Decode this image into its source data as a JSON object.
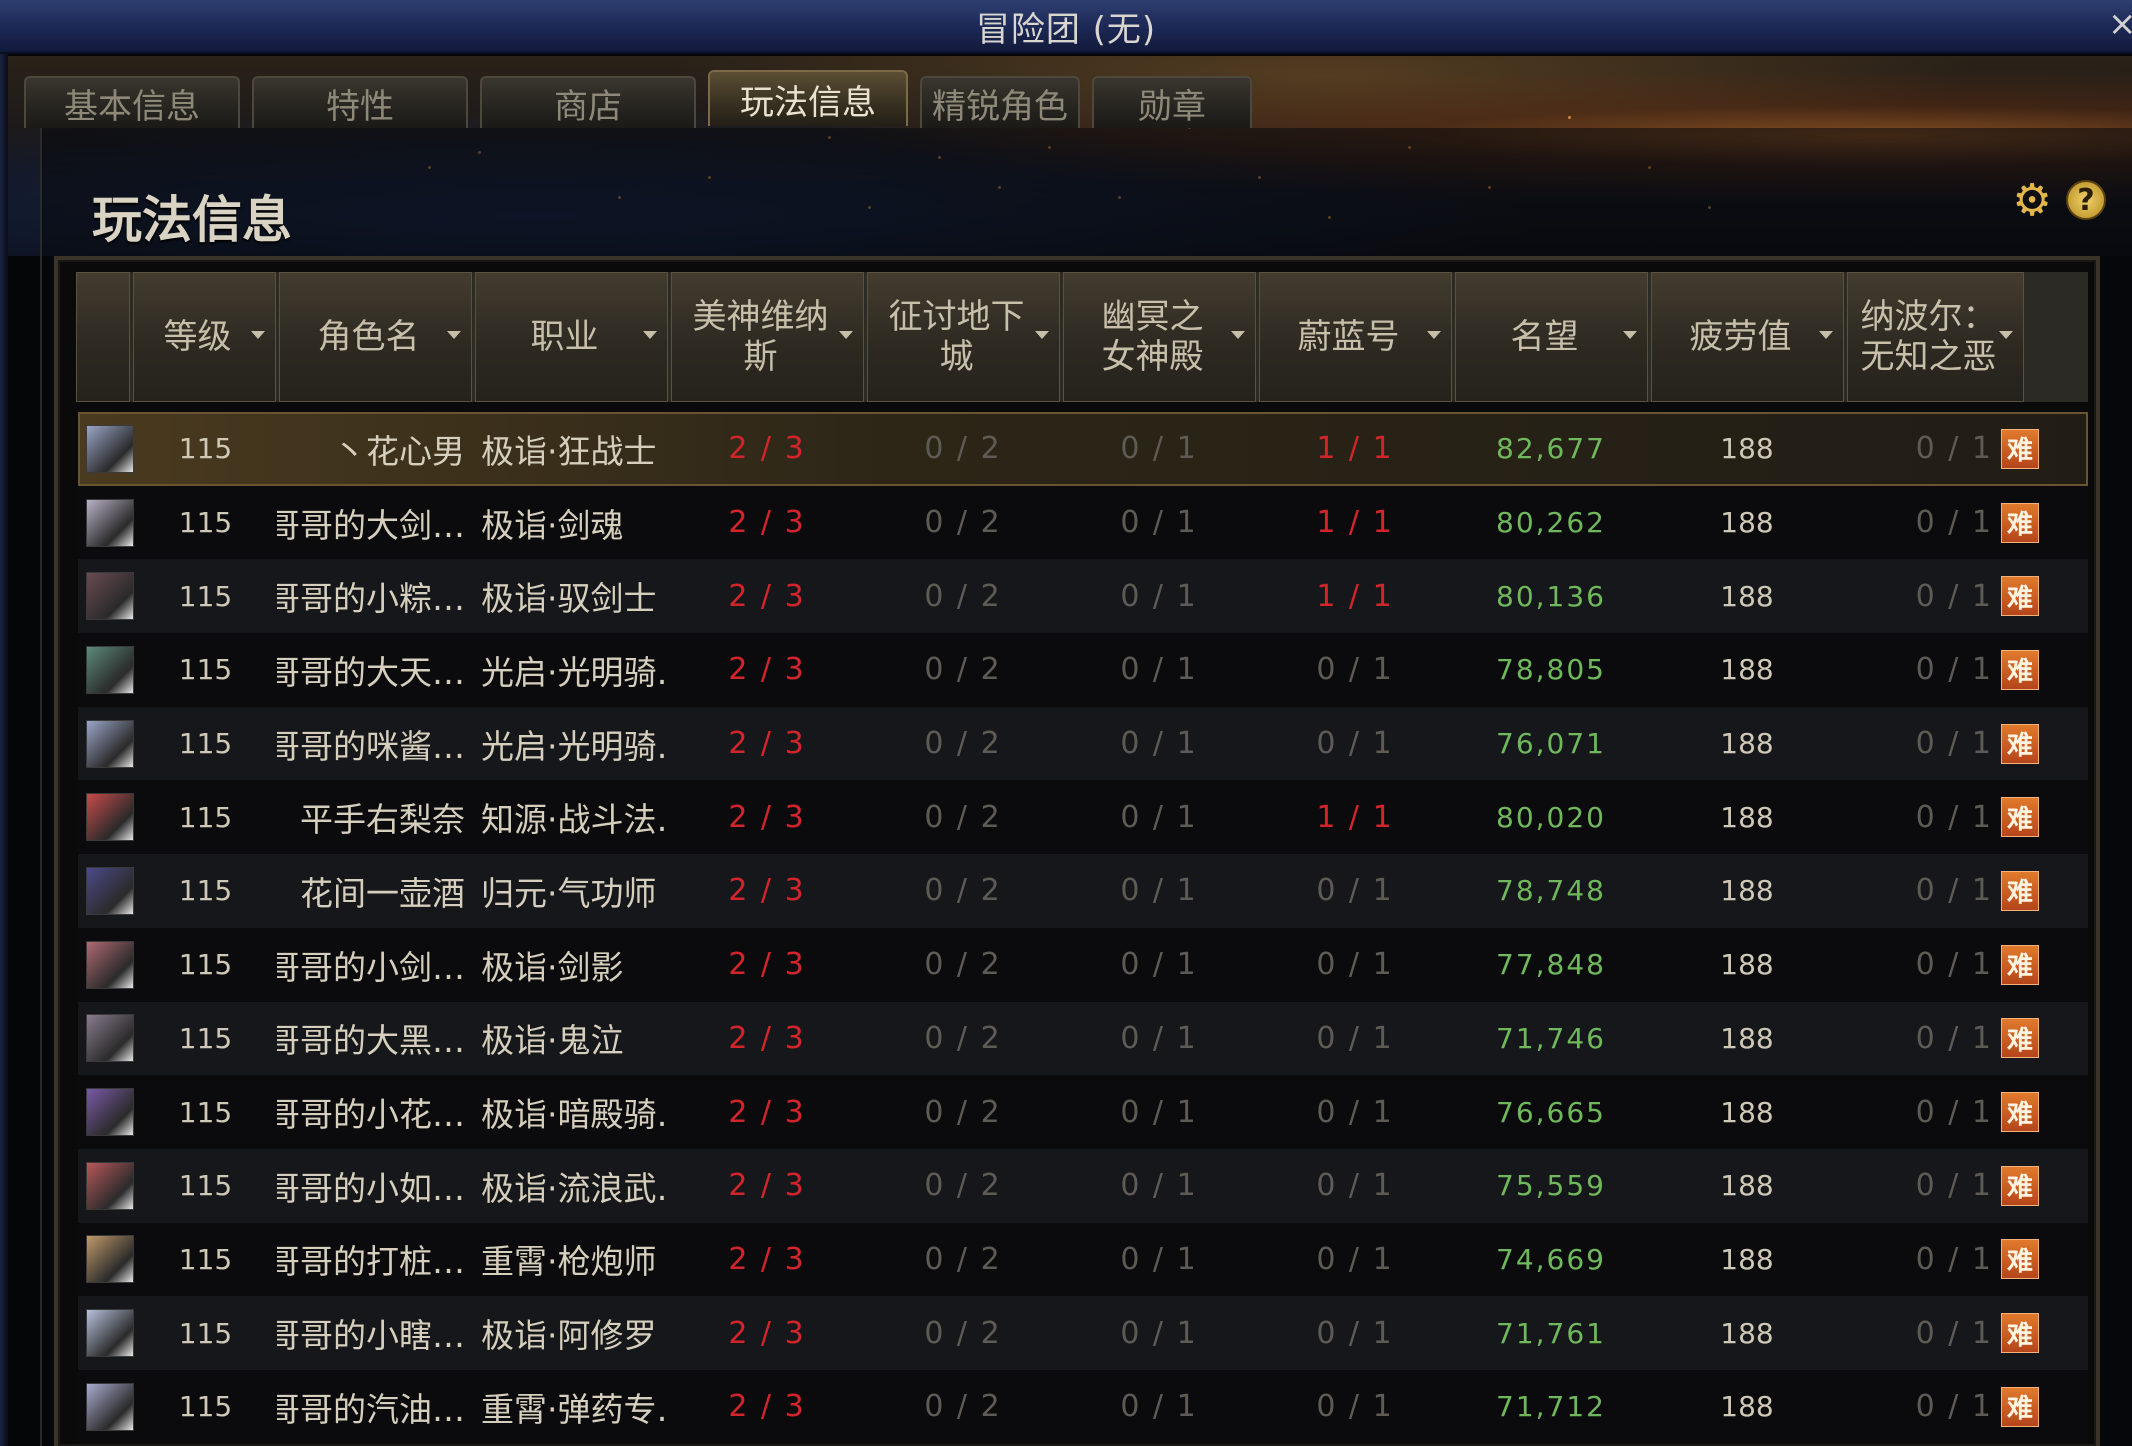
{
  "window": {
    "title": "冒险团 (无)",
    "close_glyph": "×"
  },
  "tabs": [
    {
      "label": "基本信息",
      "active": false
    },
    {
      "label": "特性",
      "active": false
    },
    {
      "label": "商店",
      "active": false
    },
    {
      "label": "玩法信息",
      "active": true
    },
    {
      "label": "精锐角色",
      "active": false
    },
    {
      "label": "勋章",
      "active": false
    }
  ],
  "panel": {
    "title": "玩法信息",
    "settings_icon": "gear-icon",
    "help_icon": "help-icon",
    "help_glyph": "?"
  },
  "columns": [
    {
      "key": "avatar",
      "label": ""
    },
    {
      "key": "level",
      "label": "等级"
    },
    {
      "key": "name",
      "label": "角色名"
    },
    {
      "key": "job",
      "label": "职业"
    },
    {
      "key": "venus",
      "label": "美神维纳\n斯"
    },
    {
      "key": "expedition",
      "label": "征讨地下\n城"
    },
    {
      "key": "goddess",
      "label": "幽冥之\n女神殿"
    },
    {
      "key": "azure",
      "label": "蔚蓝号"
    },
    {
      "key": "fame",
      "label": "名望"
    },
    {
      "key": "fatigue",
      "label": "疲劳值"
    },
    {
      "key": "nabor",
      "label": "纳波尔：\n无知之恶"
    }
  ],
  "rows": [
    {
      "level": "115",
      "name": "丶花心男",
      "job": "极诣·狂战士",
      "venus": "2 / 3",
      "expedition": "0 / 2",
      "goddess": "0 / 1",
      "azure": "1 / 1",
      "azure_done": true,
      "fame": "82,677",
      "fatigue": "188",
      "nabor": "0 / 1",
      "badge": "难",
      "avatar_color": "#9aa6c8",
      "selected": true
    },
    {
      "level": "115",
      "name": "哥哥的大剑…",
      "job": "极诣·剑魂",
      "venus": "2 / 3",
      "expedition": "0 / 2",
      "goddess": "0 / 1",
      "azure": "1 / 1",
      "azure_done": true,
      "fame": "80,262",
      "fatigue": "188",
      "nabor": "0 / 1",
      "badge": "难",
      "avatar_color": "#b9b2c7",
      "selected": false
    },
    {
      "level": "115",
      "name": "哥哥的小粽…",
      "job": "极诣·驭剑士",
      "venus": "2 / 3",
      "expedition": "0 / 2",
      "goddess": "0 / 1",
      "azure": "1 / 1",
      "azure_done": true,
      "fame": "80,136",
      "fatigue": "188",
      "nabor": "0 / 1",
      "badge": "难",
      "avatar_color": "#6a4b52",
      "selected": false
    },
    {
      "level": "115",
      "name": "哥哥的大天…",
      "job": "光启·光明骑…",
      "venus": "2 / 3",
      "expedition": "0 / 2",
      "goddess": "0 / 1",
      "azure": "0 / 1",
      "azure_done": false,
      "fame": "78,805",
      "fatigue": "188",
      "nabor": "0 / 1",
      "badge": "难",
      "avatar_color": "#5c8a7a",
      "selected": false
    },
    {
      "level": "115",
      "name": "哥哥的咪酱…",
      "job": "光启·光明骑…",
      "venus": "2 / 3",
      "expedition": "0 / 2",
      "goddess": "0 / 1",
      "azure": "0 / 1",
      "azure_done": false,
      "fame": "76,071",
      "fatigue": "188",
      "nabor": "0 / 1",
      "badge": "难",
      "avatar_color": "#9ba7c9",
      "selected": false
    },
    {
      "level": "115",
      "name": "平手右梨奈",
      "job": "知源·战斗法…",
      "venus": "2 / 3",
      "expedition": "0 / 2",
      "goddess": "0 / 1",
      "azure": "1 / 1",
      "azure_done": true,
      "fame": "80,020",
      "fatigue": "188",
      "nabor": "0 / 1",
      "badge": "难",
      "avatar_color": "#c84a4a",
      "selected": false
    },
    {
      "level": "115",
      "name": "花间一壶酒",
      "job": "归元·气功师",
      "venus": "2 / 3",
      "expedition": "0 / 2",
      "goddess": "0 / 1",
      "azure": "0 / 1",
      "azure_done": false,
      "fame": "78,748",
      "fatigue": "188",
      "nabor": "0 / 1",
      "badge": "难",
      "avatar_color": "#4b4a8a",
      "selected": false
    },
    {
      "level": "115",
      "name": "哥哥的小剑…",
      "job": "极诣·剑影",
      "venus": "2 / 3",
      "expedition": "0 / 2",
      "goddess": "0 / 1",
      "azure": "0 / 1",
      "azure_done": false,
      "fame": "77,848",
      "fatigue": "188",
      "nabor": "0 / 1",
      "badge": "难",
      "avatar_color": "#b06a72",
      "selected": false
    },
    {
      "level": "115",
      "name": "哥哥的大黑…",
      "job": "极诣·鬼泣",
      "venus": "2 / 3",
      "expedition": "0 / 2",
      "goddess": "0 / 1",
      "azure": "0 / 1",
      "azure_done": false,
      "fame": "71,746",
      "fatigue": "188",
      "nabor": "0 / 1",
      "badge": "难",
      "avatar_color": "#8a7c8f",
      "selected": false
    },
    {
      "level": "115",
      "name": "哥哥的小花…",
      "job": "极诣·暗殿骑…",
      "venus": "2 / 3",
      "expedition": "0 / 2",
      "goddess": "0 / 1",
      "azure": "0 / 1",
      "azure_done": false,
      "fame": "76,665",
      "fatigue": "188",
      "nabor": "0 / 1",
      "badge": "难",
      "avatar_color": "#7a5aa8",
      "selected": false
    },
    {
      "level": "115",
      "name": "哥哥的小如…",
      "job": "极诣·流浪武…",
      "venus": "2 / 3",
      "expedition": "0 / 2",
      "goddess": "0 / 1",
      "azure": "0 / 1",
      "azure_done": false,
      "fame": "75,559",
      "fatigue": "188",
      "nabor": "0 / 1",
      "badge": "难",
      "avatar_color": "#b8585a",
      "selected": false
    },
    {
      "level": "115",
      "name": "哥哥的打桩…",
      "job": "重霄·枪炮师",
      "venus": "2 / 3",
      "expedition": "0 / 2",
      "goddess": "0 / 1",
      "azure": "0 / 1",
      "azure_done": false,
      "fame": "74,669",
      "fatigue": "188",
      "nabor": "0 / 1",
      "badge": "难",
      "avatar_color": "#c09a6a",
      "selected": false
    },
    {
      "level": "115",
      "name": "哥哥的小瞎…",
      "job": "极诣·阿修罗",
      "venus": "2 / 3",
      "expedition": "0 / 2",
      "goddess": "0 / 1",
      "azure": "0 / 1",
      "azure_done": false,
      "fame": "71,761",
      "fatigue": "188",
      "nabor": "0 / 1",
      "badge": "难",
      "avatar_color": "#b7c2dc",
      "selected": false
    },
    {
      "level": "115",
      "name": "哥哥的汽油…",
      "job": "重霄·弹药专…",
      "venus": "2 / 3",
      "expedition": "0 / 2",
      "goddess": "0 / 1",
      "azure": "0 / 1",
      "azure_done": false,
      "fame": "71,712",
      "fatigue": "188",
      "nabor": "0 / 1",
      "badge": "难",
      "avatar_color": "#a9acd0",
      "selected": false
    }
  ]
}
